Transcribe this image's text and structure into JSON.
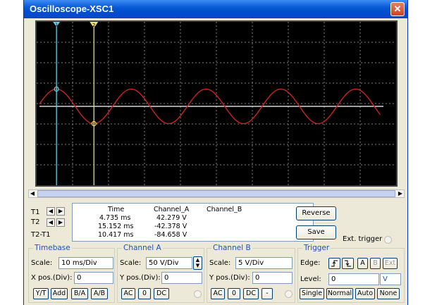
{
  "window": {
    "title": "Oscilloscope-XSC1",
    "close_glyph": "✕"
  },
  "cursors": {
    "t1_label": "T1",
    "t2_label": "T2",
    "diff_label": "T2-T1",
    "t1_marker": "1",
    "t2_marker": "2"
  },
  "readout": {
    "headers": [
      "Time",
      "Channel_A",
      "Channel_B"
    ],
    "rows": [
      {
        "time": "4.735 ms",
        "a": "42.279 V",
        "b": ""
      },
      {
        "time": "15.152 ms",
        "a": "-42.378 V",
        "b": ""
      },
      {
        "time": "10.417 ms",
        "a": "-84.658 V",
        "b": ""
      }
    ]
  },
  "buttons": {
    "reverse": "Reverse",
    "save": "Save",
    "ext_trigger": "Ext. trigger"
  },
  "timebase": {
    "title": "Timebase",
    "scale_label": "Scale:",
    "scale_value": "10 ms/Div",
    "xpos_label": "X pos.(Div):",
    "xpos_value": "0",
    "modes": [
      "Y/T",
      "Add",
      "B/A",
      "A/B"
    ]
  },
  "channel_a": {
    "title": "Channel A",
    "scale_label": "Scale:",
    "scale_value": "50  V/Div",
    "ypos_label": "Y pos.(Div):",
    "ypos_value": "0",
    "coupling": [
      "AC",
      "0",
      "DC"
    ]
  },
  "channel_b": {
    "title": "Channel B",
    "scale_label": "Scale:",
    "scale_value": "5  V/Div",
    "ypos_label": "Y pos.(Div):",
    "ypos_value": "0",
    "coupling": [
      "AC",
      "0",
      "DC",
      "-"
    ]
  },
  "trigger": {
    "title": "Trigger",
    "edge_label": "Edge:",
    "edge_buttons": [
      "A",
      "B",
      "Ext"
    ],
    "level_label": "Level:",
    "level_value": "0",
    "level_unit": "V",
    "modes": [
      "Single",
      "Normal",
      "Auto",
      "None"
    ]
  },
  "waveform": {
    "channel_a_color": "#cc2222",
    "channel_b_color": "#ffffff",
    "grid_color": "#808080",
    "cursor1_color": "#5fd3e8",
    "cursor2_color": "#e8e070",
    "amplitude_volts": 42.3,
    "period_ms": 20.8,
    "cursor1_ms": 4.735,
    "cursor2_ms": 15.152
  }
}
